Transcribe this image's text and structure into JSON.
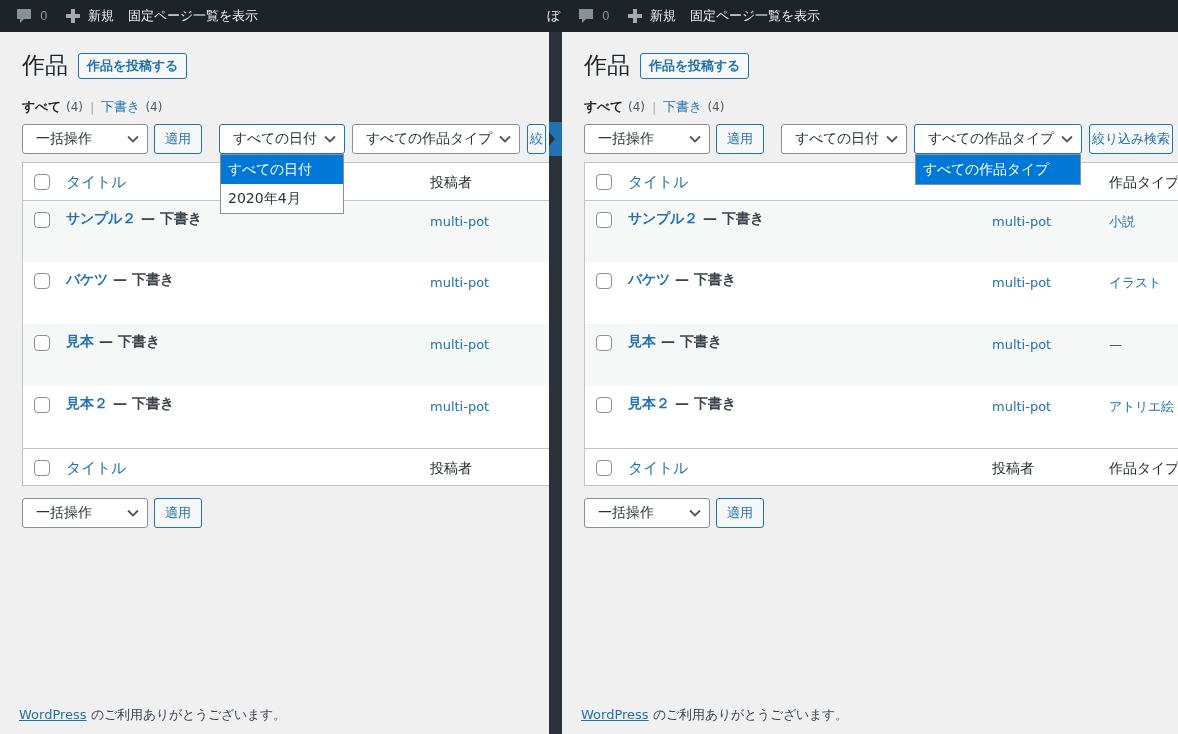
{
  "panels": [
    {
      "admin_bar": {
        "comment_count": "0",
        "new_label": "新規",
        "link": "固定ページ一覧を表示",
        "user": "ぼ"
      },
      "heading": "作品",
      "add_button": "作品を投稿する",
      "views": [
        {
          "label": "すべて",
          "count": "(4)",
          "selected": true
        },
        {
          "separator": "|",
          "label": "下書き",
          "count": "(4)",
          "selected": false
        }
      ],
      "bulk_actions": {
        "value": "一括操作",
        "button": "適用"
      },
      "filters": [
        {
          "kind": "select",
          "value": "すべての日付",
          "expanded": true,
          "options": [
            {
              "label": "すべての日付",
              "selected": true
            },
            {
              "label": "2020年4月",
              "selected": false
            }
          ]
        },
        {
          "kind": "select",
          "value": "すべての作品タイプ",
          "expanded": false
        },
        {
          "kind": "button",
          "label": "絞"
        }
      ],
      "header": {
        "checked": false,
        "columns": [
          {
            "kind": "title",
            "label": "タイトル"
          },
          {
            "kind": "author",
            "label": "投稿者"
          }
        ]
      },
      "rows": [
        {
          "checked": false,
          "title": "サンプル２",
          "status": "— 下書き",
          "author": "multi-pot"
        },
        {
          "checked": false,
          "title": "バケツ",
          "status": "— 下書き",
          "author": "multi-pot"
        },
        {
          "checked": false,
          "title": "見本",
          "status": "— 下書き",
          "author": "multi-pot"
        },
        {
          "checked": false,
          "title": "見本２",
          "status": "— 下書き",
          "author": "multi-pot"
        }
      ],
      "footer_header": {
        "checked": false,
        "columns": [
          {
            "kind": "title",
            "label": "タイトル"
          },
          {
            "kind": "author",
            "label": "投稿者"
          }
        ]
      },
      "bottom_bulk_actions": {
        "value": "一括操作",
        "button": "適用"
      },
      "footer_note": {
        "link": "WordPress",
        "text": "のご利用ありがとうございます。"
      }
    },
    {
      "admin_bar": {
        "comment_count": "0",
        "new_label": "新規",
        "link": "固定ページ一覧を表示"
      },
      "heading": "作品",
      "add_button": "作品を投稿する",
      "views": [
        {
          "label": "すべて",
          "count": "(4)",
          "selected": true
        },
        {
          "separator": "|",
          "label": "下書き",
          "count": "(4)",
          "selected": false
        }
      ],
      "bulk_actions": {
        "value": "一括操作",
        "button": "適用"
      },
      "filters": [
        {
          "kind": "select",
          "value": "すべての日付",
          "expanded": false
        },
        {
          "kind": "select",
          "value": "すべての作品タイプ",
          "expanded": true,
          "options": [
            {
              "label": "すべての作品タイプ",
              "selected": true
            }
          ]
        },
        {
          "kind": "button",
          "label": "絞り込み検索"
        }
      ],
      "header": {
        "checked": false,
        "columns": [
          {
            "kind": "title",
            "label": "タイトル"
          },
          {
            "kind": "type",
            "label": "作品タイプ"
          }
        ]
      },
      "rows": [
        {
          "checked": false,
          "title": "サンプル２",
          "status": "— 下書き",
          "author": "multi-pot",
          "type": {
            "label": "小説",
            "linked": true
          }
        },
        {
          "checked": false,
          "title": "バケツ",
          "status": "— 下書き",
          "author": "multi-pot",
          "type": {
            "label": "イラスト",
            "linked": true
          }
        },
        {
          "checked": false,
          "title": "見本",
          "status": "— 下書き",
          "author": "multi-pot",
          "type": {
            "label": "—",
            "linked": false
          }
        },
        {
          "checked": false,
          "title": "見本２",
          "status": "— 下書き",
          "author": "multi-pot",
          "type": {
            "label": "アトリエ絵",
            "linked": true
          }
        }
      ],
      "footer_header": {
        "checked": false,
        "columns": [
          {
            "kind": "title",
            "label": "タイトル"
          },
          {
            "kind": "author",
            "label": "投稿者"
          },
          {
            "kind": "type",
            "label": "作品タイプ"
          }
        ]
      },
      "bottom_bulk_actions": {
        "value": "一括操作",
        "button": "適用"
      },
      "footer_note": {
        "link": "WordPress",
        "text": "のご利用ありがとうございます。"
      }
    }
  ]
}
